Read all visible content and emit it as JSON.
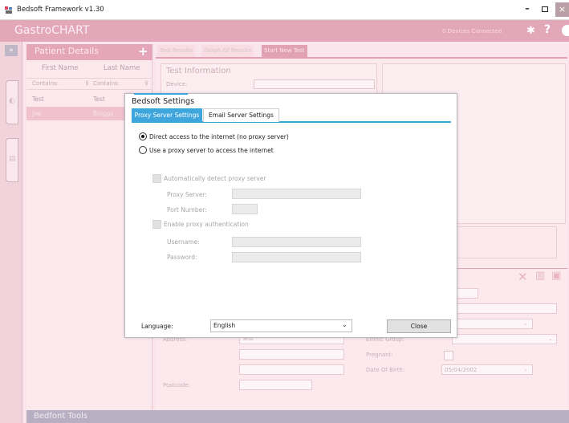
{
  "window": {
    "title": "Bedsoft Framework v1.30",
    "minimize_glyph": "–",
    "close_glyph": "×"
  },
  "app": {
    "brand": "GastroCHART",
    "devices_status": "0 Devices Connected",
    "patient_details": {
      "title": "Patient Details",
      "add_glyph": "+",
      "columns": [
        "First Name",
        "Last Name"
      ],
      "filter_label": "Contains:",
      "rows": [
        {
          "first": "Test",
          "last": "Test"
        },
        {
          "first": "Joe",
          "last": "Bloggs"
        }
      ]
    },
    "tabs": [
      "Test Results",
      "Graph Of Results",
      "Start New Test"
    ],
    "test_information": {
      "title": "Test Information",
      "device_label": "Device:"
    },
    "patient_form": {
      "address_label": "Address:",
      "address_value": "Test",
      "postcode_label": "Postcode:",
      "ethnic_label": "Ethnic Group:",
      "pregnant_label": "Pregnant:",
      "dob_label": "Date Of Birth:",
      "dob_value": "05/04/2002"
    },
    "bottom_bar_title": "Bedfont Tools"
  },
  "dialog": {
    "title": "Bedsoft Settings",
    "tabs": [
      {
        "label": "Proxy Server Settings",
        "active": true
      },
      {
        "label": "Email Server Settings",
        "active": false
      }
    ],
    "proxy": {
      "option_direct": "Direct access to the internet (no proxy server)",
      "option_proxy": "Use a proxy server to access the internet",
      "selected": "direct",
      "auto_detect_label": "Automatically detect proxy server",
      "proxy_server_label": "Proxy Server:",
      "proxy_server_value": "",
      "port_label": "Port Number:",
      "port_value": "",
      "auth_label": "Enable proxy authentication",
      "username_label": "Username:",
      "username_value": "",
      "password_label": "Password:",
      "password_value": ""
    },
    "language_label": "Language:",
    "language_value": "English",
    "close_label": "Close"
  },
  "colors": {
    "accent": "#3ea6dc",
    "app_pink": "#e3a7ba"
  }
}
